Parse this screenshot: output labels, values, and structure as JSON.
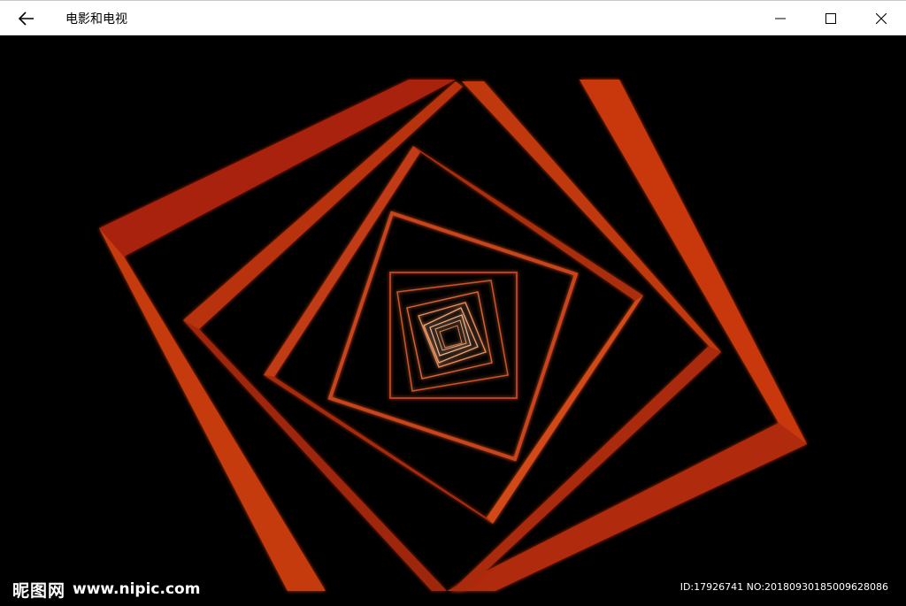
{
  "window": {
    "title": "电影和电视",
    "controls": {
      "back": "back-arrow-icon",
      "minimize": "minimize-icon",
      "maximize": "maximize-icon",
      "close": "close-icon"
    }
  },
  "video": {
    "content": "orange-square-spiral-tunnel",
    "accent_color": "#e0501a",
    "glow_color": "#ff8a3a"
  },
  "watermark": {
    "site_name": "昵图网",
    "site_url": "www.nipic.com",
    "id_text": "ID:17926741 NO:20180930185009628086"
  }
}
